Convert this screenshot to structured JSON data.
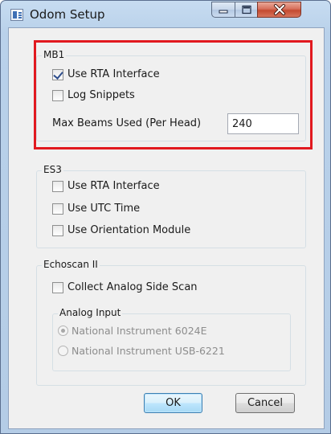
{
  "window": {
    "title": "Odom Setup",
    "accent_color": "#e1191f"
  },
  "mb1": {
    "title": "MB1",
    "use_rta_interface": {
      "label": "Use RTA Interface",
      "checked": true
    },
    "log_snippets": {
      "label": "Log Snippets",
      "checked": false
    },
    "max_beams_label": "Max Beams Used (Per Head)",
    "max_beams_value": "240"
  },
  "es3": {
    "title": "ES3",
    "use_rta_interface": {
      "label": "Use RTA Interface",
      "checked": false
    },
    "use_utc_time": {
      "label": "Use UTC Time",
      "checked": false
    },
    "use_orientation_module": {
      "label": "Use Orientation Module",
      "checked": false
    }
  },
  "echoscan": {
    "title": "Echoscan II",
    "collect_analog_side_scan": {
      "label": "Collect Analog Side Scan",
      "checked": false
    },
    "analog_input": {
      "title": "Analog Input",
      "options": [
        {
          "label": "National Instrument 6024E",
          "selected": true
        },
        {
          "label": "National Instrument USB-6221",
          "selected": false
        }
      ]
    }
  },
  "buttons": {
    "ok": "OK",
    "cancel": "Cancel"
  }
}
